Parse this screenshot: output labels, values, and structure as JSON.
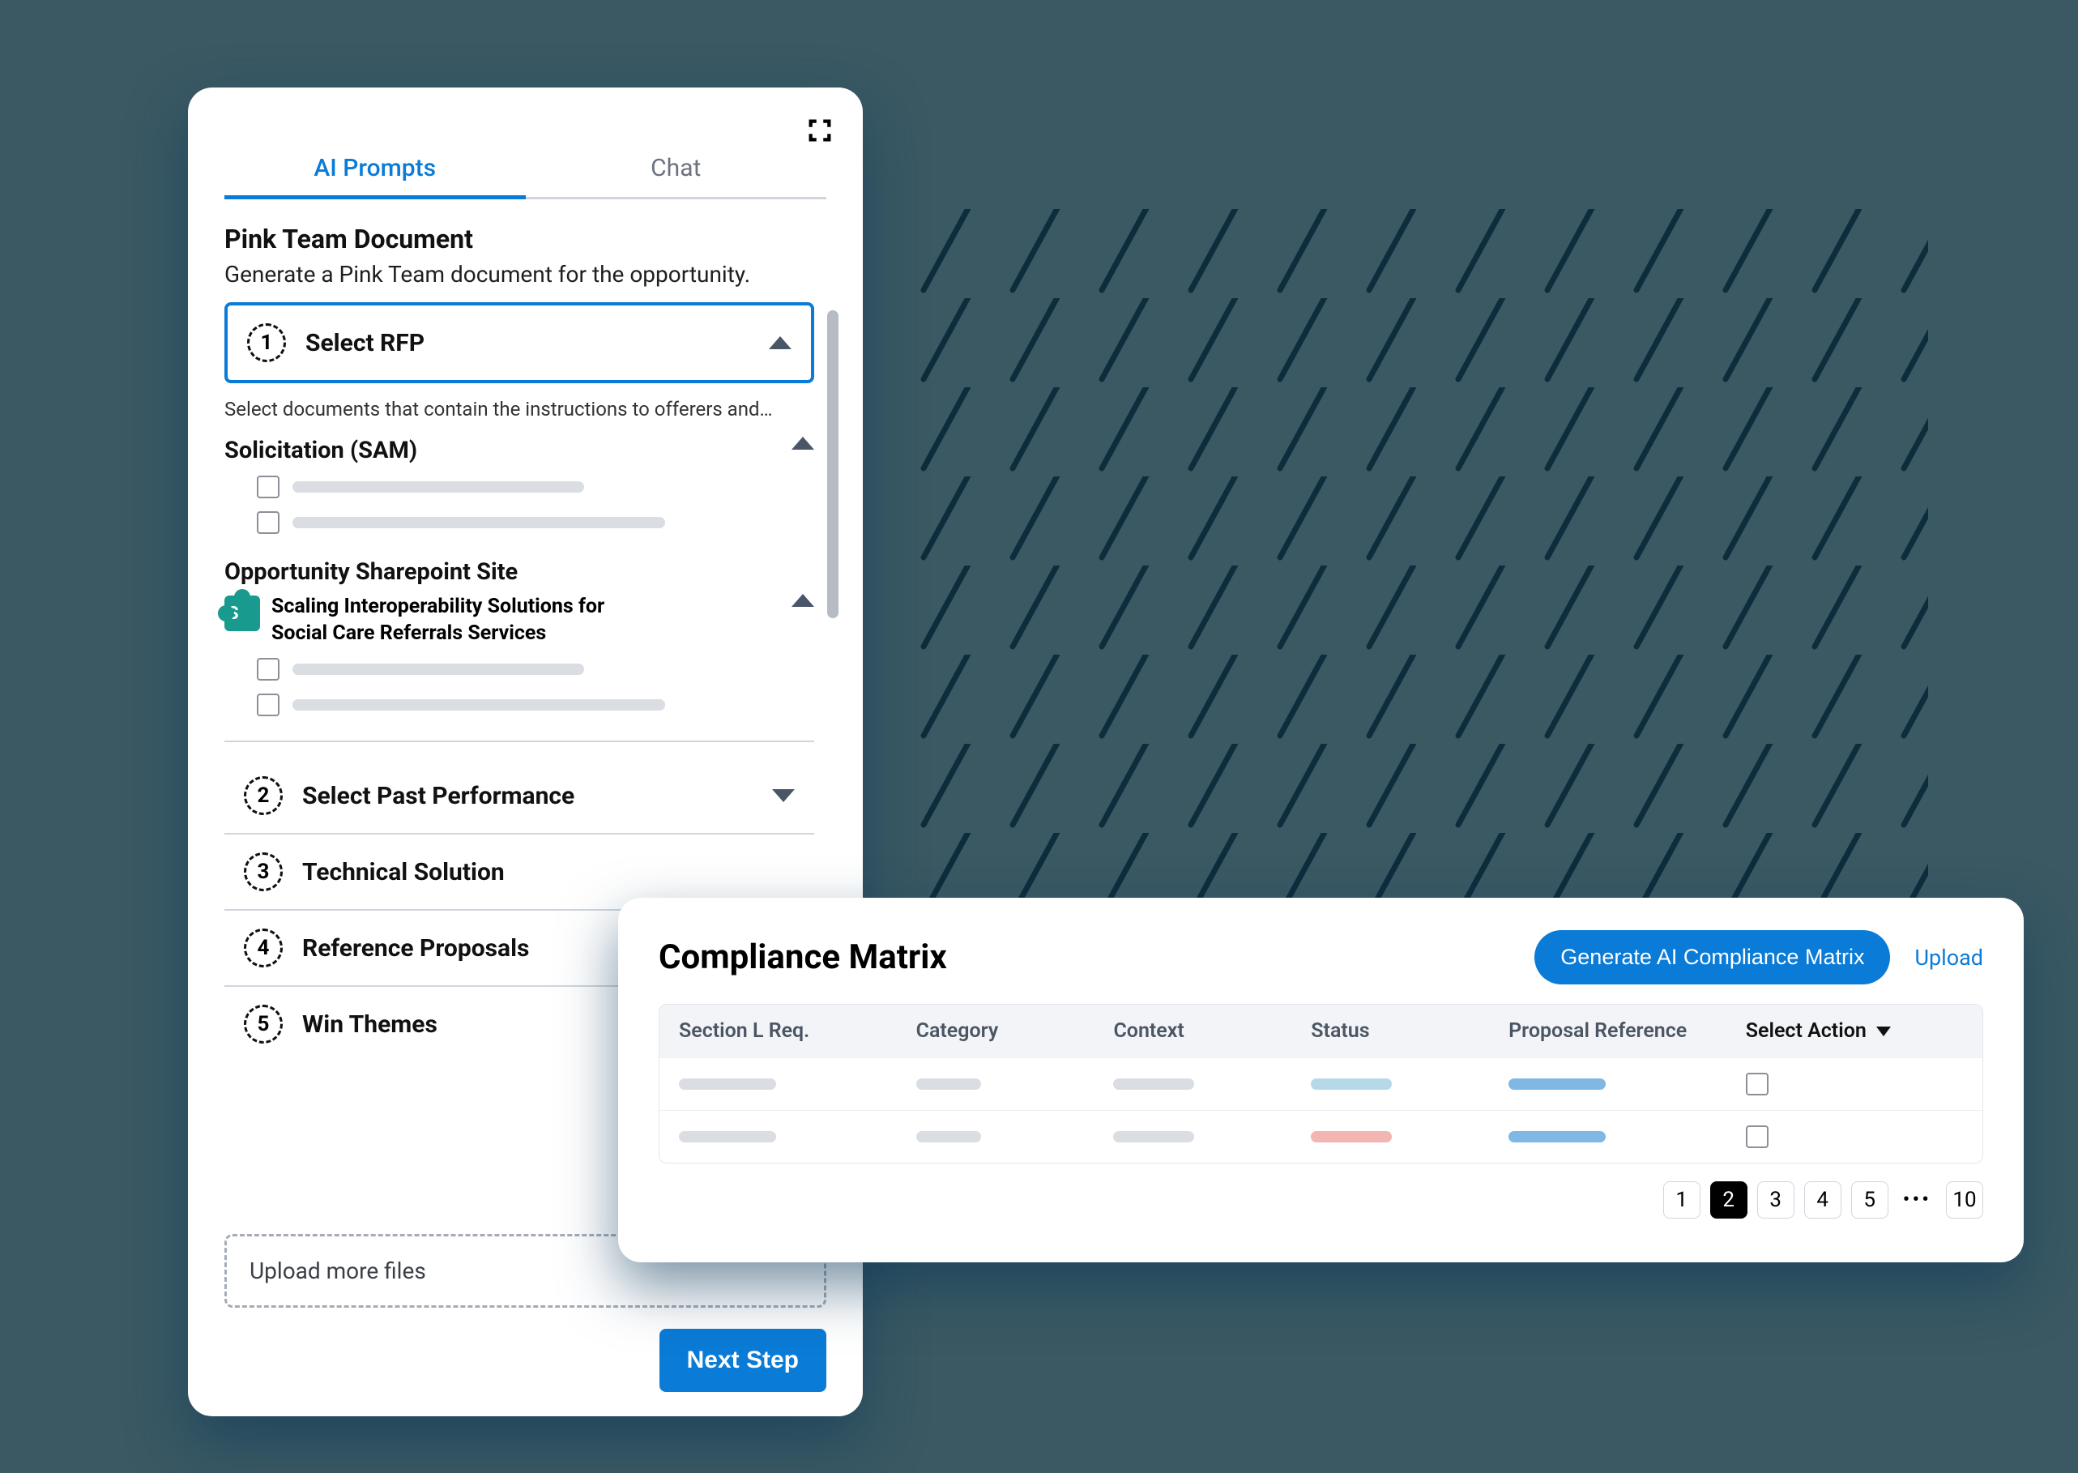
{
  "tabs": {
    "ai_prompts": "AI Prompts",
    "chat": "Chat"
  },
  "pink_team": {
    "title": "Pink Team Document",
    "desc": "Generate a Pink Team document for the opportunity.",
    "hint": "Select documents that contain the instructions to offerers and…"
  },
  "steps": {
    "s1": {
      "num": "1",
      "label": "Select RFP"
    },
    "s2": {
      "num": "2",
      "label": "Select Past Performance"
    },
    "s3": {
      "num": "3",
      "label": "Technical Solution"
    },
    "s4": {
      "num": "4",
      "label": "Reference Proposals"
    },
    "s5": {
      "num": "5",
      "label": "Win Themes"
    }
  },
  "groups": {
    "solicitation_title": "Solicitation (SAM)",
    "sp_title": "Opportunity Sharepoint Site",
    "sp_subtitle": "Scaling Interoperability Solutions for Social Care Referrals Services",
    "sp_badge": "S"
  },
  "upload_drop": "Upload more files",
  "next_step": "Next Step",
  "compliance": {
    "title": "Compliance Matrix",
    "generate": "Generate AI Compliance Matrix",
    "upload": "Upload",
    "cols": {
      "section": "Section L Req.",
      "category": "Category",
      "context": "Context",
      "status": "Status",
      "propref": "Proposal Reference",
      "action": "Select Action"
    },
    "pages": [
      "1",
      "2",
      "3",
      "4",
      "5",
      "10"
    ],
    "active_page": "2"
  }
}
